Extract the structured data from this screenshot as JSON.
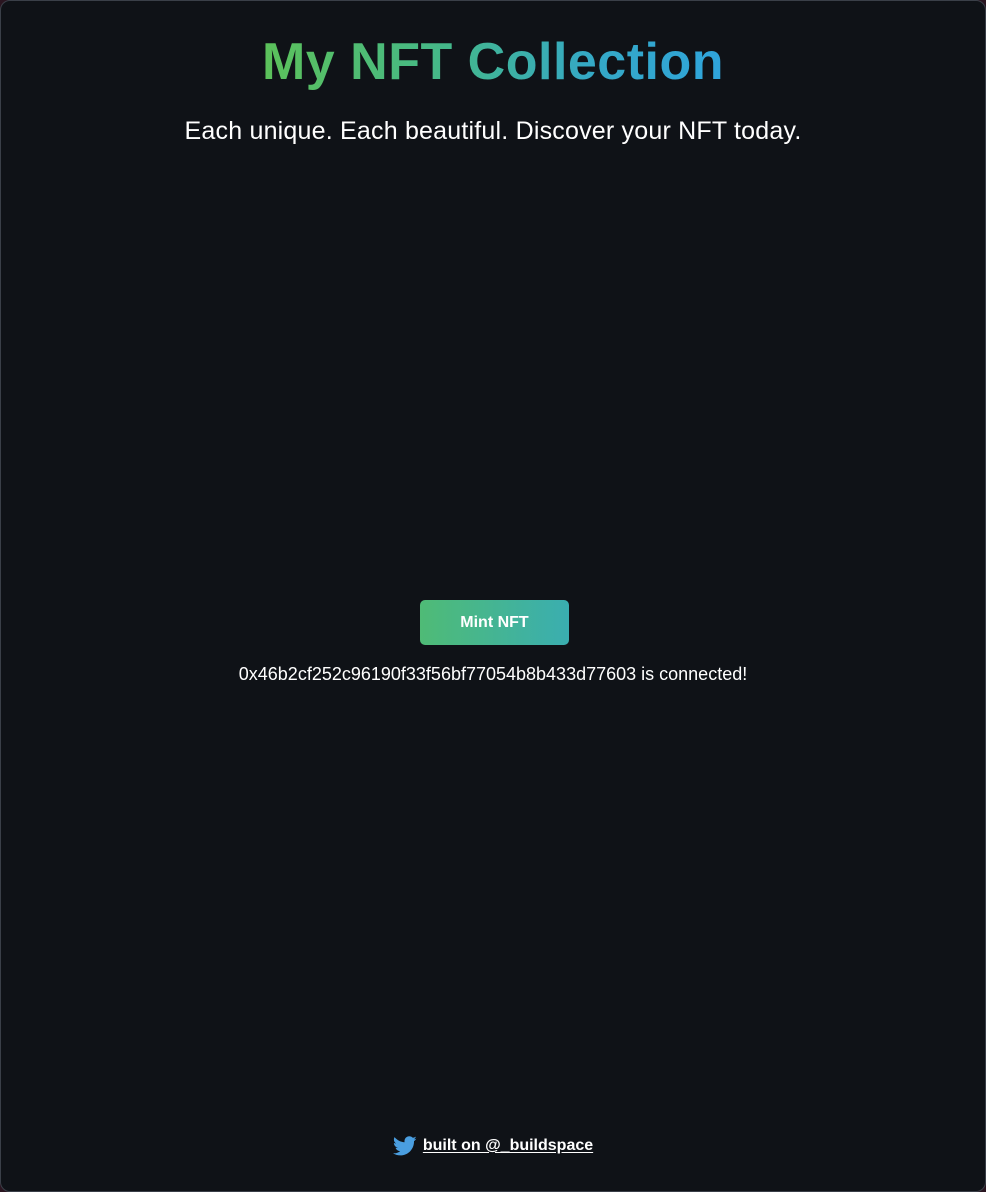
{
  "header": {
    "title": "My NFT Collection",
    "subtitle": "Each unique. Each beautiful. Discover your NFT today."
  },
  "main": {
    "mint_button_label": "Mint NFT",
    "connected_status": "0x46b2cf252c96190f33f56bf77054b8b433d77603 is connected!"
  },
  "footer": {
    "icon": "twitter-icon",
    "link_text": "built on @_buildspace"
  },
  "colors": {
    "background": "#0f1217",
    "title_gradient_start": "#5cc15a",
    "title_gradient_end": "#2fa4dc",
    "button_gradient_start": "#4fbb76",
    "button_gradient_end": "#3aaeb0",
    "twitter_blue": "#4a9ee0",
    "text": "#ffffff"
  }
}
